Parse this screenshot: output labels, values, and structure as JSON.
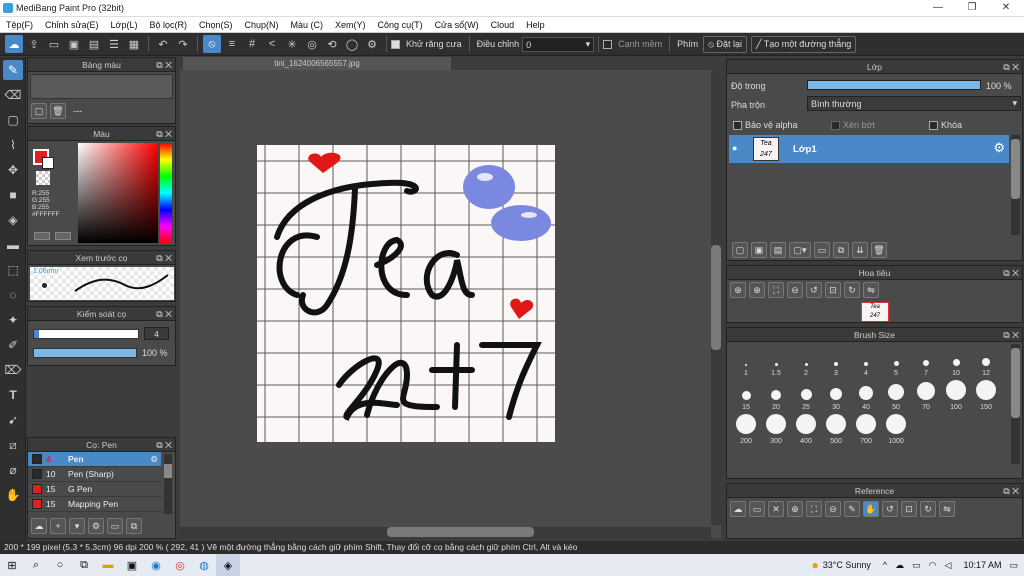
{
  "window": {
    "title": "MediBang Paint Pro (32bit)",
    "minimize": "—",
    "restore": "❐",
    "close": "✕"
  },
  "menu": [
    "Tệp(F)",
    "Chỉnh sửa(E)",
    "Lớp(L)",
    "Bộ lọc(R)",
    "Chọn(S)",
    "Chụp(N)",
    "Màu (C)",
    "Xem(Y)",
    "Công cụ(T)",
    "Cửa sổ(W)",
    "Cloud",
    "Help"
  ],
  "toolbar": {
    "antialias_label": "Khử răng cưa",
    "adjust_label": "Điều chỉnh",
    "adjust_value": "0",
    "edge_label": "Cạnh mềm",
    "key_label": "Phím",
    "reset_label": "Đặt lại",
    "line_label": "Tạo một đường thẳng"
  },
  "doc": {
    "tab_name": "tini_1624006565557.jpg"
  },
  "palette": {
    "title": "Bảng màu",
    "list_text": "---"
  },
  "color": {
    "title": "Màu",
    "r": "R:255",
    "g": "G:255",
    "b": "B:255",
    "hex": "#FFFFFF",
    "hue_color": "#ff0000"
  },
  "brush_preview": {
    "title": "Xem trước cọ",
    "size": "1.06mm"
  },
  "brush_control": {
    "title": "Kiểm soát cọ",
    "size_value": "4",
    "size_fill": 0.9,
    "opacity_value": "100 %",
    "opacity_fill": 1.0
  },
  "pen_panel": {
    "title": "Cọ: Pen",
    "items": [
      {
        "size": "4",
        "name": "Pen",
        "color": "#2a2a2a",
        "selected": true
      },
      {
        "size": "10",
        "name": "Pen (Sharp)",
        "color": "#2a2a2a",
        "selected": false
      },
      {
        "size": "15",
        "name": "G Pen",
        "color": "#e02020",
        "selected": false
      },
      {
        "size": "15",
        "name": "Mapping Pen",
        "color": "#e02020",
        "selected": false
      }
    ]
  },
  "layer": {
    "title": "Lớp",
    "opacity_label": "Độ trong",
    "opacity_value": "100 %",
    "opacity_fill": 1.0,
    "blend_label": "Pha trộn",
    "blend_value": "Bình thường",
    "protect_alpha": "Bảo vệ alpha",
    "clipping": "Xén bớt",
    "lock": "Khóa",
    "layer_name": "Lớp1"
  },
  "navigator": {
    "title": "Hoa tiêu"
  },
  "brush_size": {
    "title": "Brush Size",
    "sizes": [
      "1",
      "1.5",
      "2",
      "3",
      "4",
      "5",
      "7",
      "10",
      "12",
      "15",
      "20",
      "25",
      "30",
      "40",
      "50",
      "70",
      "100",
      "150",
      "200",
      "300",
      "400",
      "500",
      "700",
      "1000"
    ]
  },
  "reference": {
    "title": "Reference"
  },
  "status": {
    "text": "200 * 199 pixel   (5.3 * 5.3cm)   96 dpi   200 %   ( 292, 41 )   Vẽ một đường thẳng bằng cách giữ phím Shift, Thay đổi cỡ cọ bằng cách giữ phím Ctrl, Alt và kéo"
  },
  "taskbar": {
    "weather": "33°C  Sunny",
    "time": "10:17 AM"
  },
  "colors": {
    "accent": "#4a89c8",
    "panel": "#4a4a4a",
    "canvas_bg": "#4b4b4b"
  }
}
